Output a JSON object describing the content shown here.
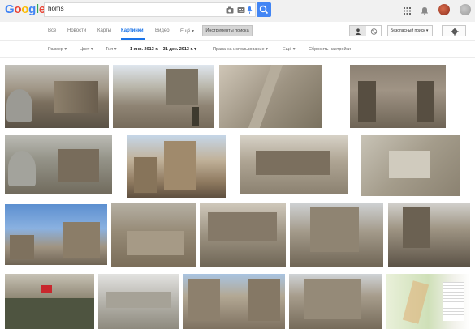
{
  "header": {
    "logo": [
      "G",
      "o",
      "o",
      "g",
      "l",
      "e"
    ],
    "logo_colors": [
      "#4285f4",
      "#ea4335",
      "#fbbc05",
      "#4285f4",
      "#34a853",
      "#ea4335"
    ],
    "search_value": "homs"
  },
  "tabs": [
    {
      "label": "Все",
      "active": false
    },
    {
      "label": "Новости",
      "active": false
    },
    {
      "label": "Карты",
      "active": false
    },
    {
      "label": "Картинки",
      "active": true
    },
    {
      "label": "Видео",
      "active": false
    },
    {
      "label": "Ещё ▾",
      "active": false
    }
  ],
  "tools_label": "Инструменты поиска",
  "safe_search_label": "Безопасный поиск ▾",
  "filters": {
    "size": "Размер ▾",
    "color": "Цвет ▾",
    "type": "Тип ▾",
    "date": "1 янв. 2013 г. – 31 дек. 2013 г. ▾",
    "rights": "Права на использование ▾",
    "more": "Ещё ▾",
    "reset": "Сбросить настройки"
  },
  "colors": {
    "accent": "#1a73e8",
    "search_button": "#4285f4"
  }
}
